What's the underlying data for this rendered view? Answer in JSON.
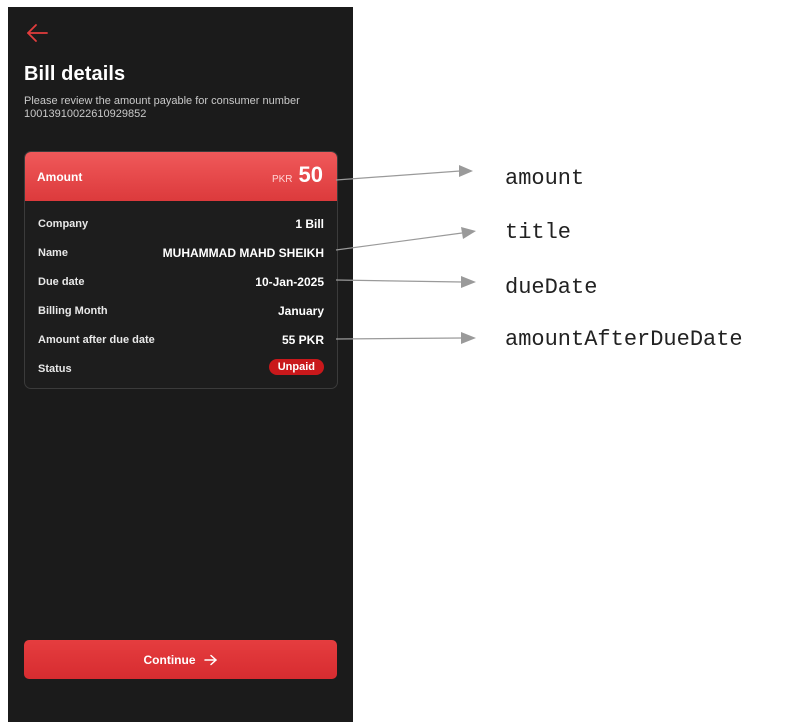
{
  "screen": {
    "title": "Bill details",
    "subtitle": "Please review the amount payable for consumer number 10013910022610929852",
    "back_icon": "back-arrow-icon"
  },
  "amount_card": {
    "label": "Amount",
    "currency": "PKR",
    "value": "50",
    "rows": [
      {
        "key": "Company",
        "value": "1 Bill"
      },
      {
        "key": "Name",
        "value": "MUHAMMAD MAHD SHEIKH"
      },
      {
        "key": "Due date",
        "value": "10-Jan-2025"
      },
      {
        "key": "Billing Month",
        "value": "January"
      },
      {
        "key": "Amount after due date",
        "value": "55 PKR"
      },
      {
        "key": "Status",
        "value": "Unpaid"
      }
    ]
  },
  "continue_button": {
    "label": "Continue",
    "icon": "arrow-right-icon"
  },
  "annotations": [
    {
      "label": "amount"
    },
    {
      "label": "title"
    },
    {
      "label": "dueDate"
    },
    {
      "label": "amountAfterDueDate"
    }
  ],
  "colors": {
    "background": "#1b1b1b",
    "accent": "#e53d3f",
    "status_unpaid": "#c9181b"
  }
}
